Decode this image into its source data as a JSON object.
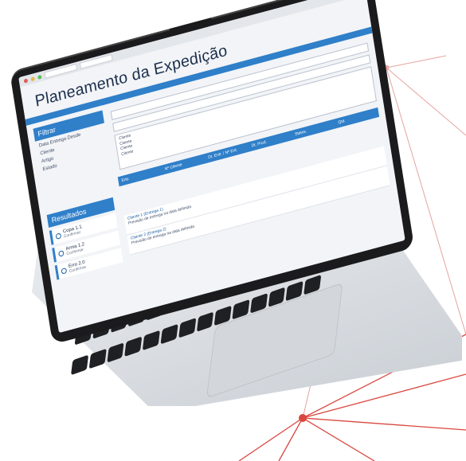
{
  "app": {
    "title": "Planeamento da Expedição"
  },
  "filter": {
    "header": "Filtrar",
    "labels": [
      "Data Entrega Desde",
      "Cliente",
      "Artigo",
      "Estado"
    ],
    "list_options": [
      "Cliente",
      "Cliente",
      "Cliente",
      "Cliente"
    ]
  },
  "grid": {
    "headers": [
      "Entr.",
      "Nº Cliente",
      "Dt. Entr. / Nº Ent.",
      "Dt. Prod.",
      "Status",
      "Qtd."
    ]
  },
  "results": {
    "header": "Resultados",
    "items": [
      {
        "label": "Copa 1.1",
        "sub": "Confirmar"
      },
      {
        "label": "Arma 1.2",
        "sub": "Confirmar"
      },
      {
        "label": "Erro 2.0",
        "sub": "Confirmar"
      }
    ]
  },
  "rows": [
    {
      "title": "Cliente 1 (Entrega 1)",
      "text": "Previsão de entrega na data definida"
    },
    {
      "title": "Cliente 2 (Entrega 2)",
      "text": "Previsão de entrega na data definida"
    }
  ],
  "colors": {
    "accent": "#2f7fc9",
    "title": "#1d2f4d",
    "network": "#d9473f"
  }
}
